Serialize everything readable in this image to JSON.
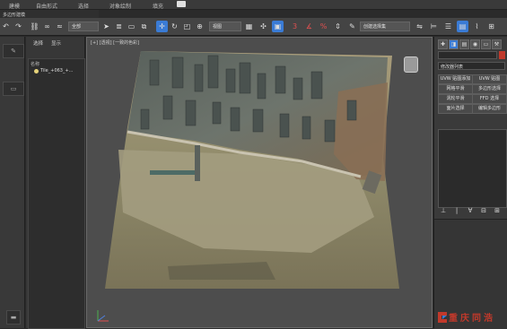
{
  "menu": [
    "建模",
    "自由形式",
    "选择",
    "对象绘制",
    "填充"
  ],
  "ribbon_label": "多边形建模",
  "toolbar": {
    "selection_filter": "全部",
    "view_dropdown": "视图",
    "named_selection": "创建选择集"
  },
  "explorer": {
    "tabs": [
      "选择",
      "显示"
    ],
    "tree_header": "名称",
    "tree_item": "Tile_+063_+..."
  },
  "viewport": {
    "label": "[+] [透视] [一致的色彩]"
  },
  "right_panel": {
    "name_field": "",
    "modifier_list": "修改器列表",
    "buttons": [
      "UVW 贴图添加",
      "UVW 贴图",
      "网格平滑",
      "多边形选择",
      "涡轮平滑",
      "FFD 选择",
      "面片选择",
      "编辑多边形"
    ],
    "stack_tools": [
      "⊥",
      "|",
      "∀",
      "⊟",
      "⊞"
    ]
  },
  "watermark": {
    "text": "重庆同浩"
  },
  "colors": {
    "viewport_bg": "#4d4d4d",
    "panel_bg": "#3a3a3a",
    "accent_blue": "#3a7bd5",
    "watermark_red": "#c1392b"
  }
}
